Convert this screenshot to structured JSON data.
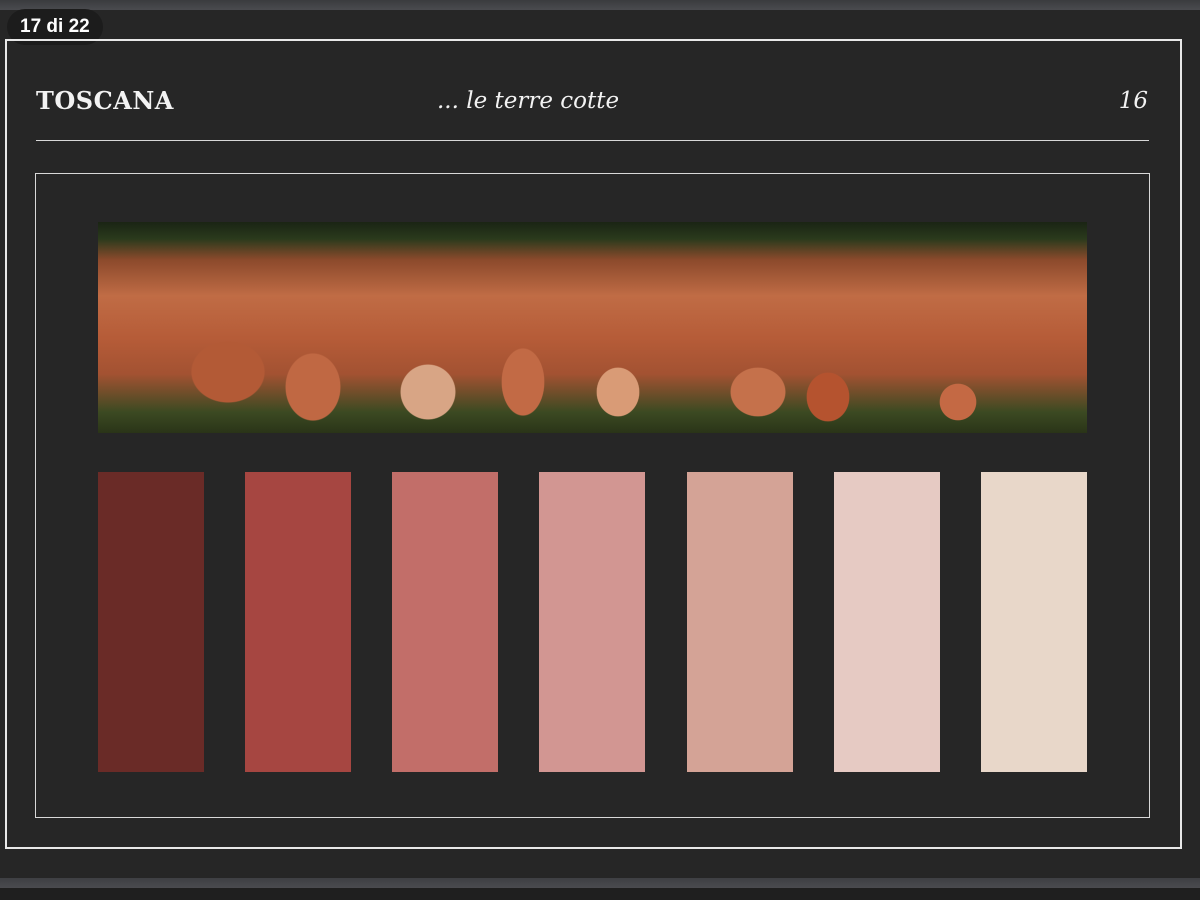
{
  "viewer": {
    "slide_counter": "17 di 22"
  },
  "slide": {
    "title": "TOSCANA",
    "subtitle": "... le terre cotte",
    "page_number": "16",
    "photo_alt": "terracotta pots",
    "palette": [
      "#6a2b27",
      "#a64641",
      "#c26e69",
      "#d29692",
      "#d4a396",
      "#e6cac3",
      "#e8d7c9"
    ]
  }
}
